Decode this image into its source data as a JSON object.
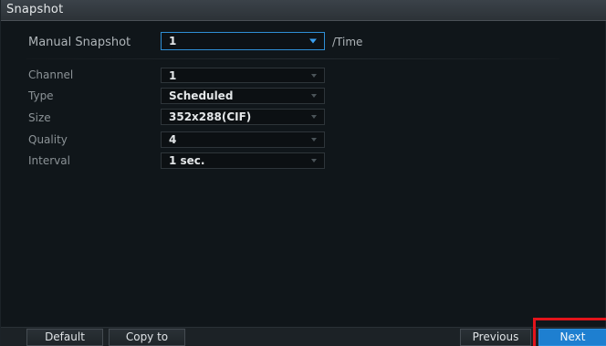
{
  "window": {
    "title": "Snapshot"
  },
  "manual_snapshot": {
    "label": "Manual Snapshot",
    "value": "1",
    "unit": "/Time"
  },
  "fields": [
    {
      "label": "Channel",
      "value": "1"
    },
    {
      "label": "Type",
      "value": "Scheduled"
    },
    {
      "label": "Size",
      "value": "352x288(CIF)"
    },
    {
      "label": "Quality",
      "value": "4"
    },
    {
      "label": "Interval",
      "value": "1 sec."
    }
  ],
  "footer": {
    "default_label": "Default",
    "copy_label": "Copy to",
    "previous_label": "Previous",
    "next_label": "Next"
  },
  "colors": {
    "accent": "#1e7fd0",
    "highlight": "#e3141b"
  }
}
